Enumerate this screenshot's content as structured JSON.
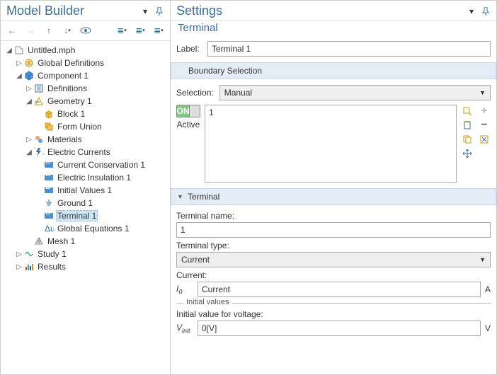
{
  "left": {
    "title": "Model Builder",
    "tree": {
      "root": {
        "label": "Untitled.mph"
      },
      "globaldefs": {
        "label": "Global Definitions"
      },
      "component": {
        "label": "Component 1"
      },
      "definitions": {
        "label": "Definitions"
      },
      "geometry": {
        "label": "Geometry 1"
      },
      "block": {
        "label": "Block 1"
      },
      "formunion": {
        "label": "Form Union"
      },
      "materials": {
        "label": "Materials"
      },
      "ec": {
        "label": "Electric Currents"
      },
      "cc": {
        "label": "Current Conservation 1"
      },
      "ei": {
        "label": "Electric Insulation 1"
      },
      "iv": {
        "label": "Initial Values 1"
      },
      "gnd": {
        "label": "Ground 1"
      },
      "term": {
        "label": "Terminal 1"
      },
      "ge": {
        "label": "Global Equations 1"
      },
      "mesh": {
        "label": "Mesh 1"
      },
      "study": {
        "label": "Study 1"
      },
      "results": {
        "label": "Results"
      }
    }
  },
  "right": {
    "title": "Settings",
    "subtitle": "Terminal",
    "label_caption": "Label:",
    "label_value": "Terminal 1",
    "section_boundary": "Boundary Selection",
    "selection_caption": "Selection:",
    "selection_value": "Manual",
    "active_caption": "Active",
    "list_item": "1",
    "section_terminal": "Terminal",
    "tname_caption": "Terminal name:",
    "tname_value": "1",
    "ttype_caption": "Terminal type:",
    "ttype_value": "Current",
    "current_caption": "Current:",
    "ivar": "I",
    "isub": "0",
    "ivalue": "Current",
    "iunit": "A",
    "initvals_legend": "Initial values",
    "initv_caption": "Initial value for voltage:",
    "vvar": "V",
    "vsub": "init",
    "vvalue": "0[V]",
    "vunit": "V"
  }
}
